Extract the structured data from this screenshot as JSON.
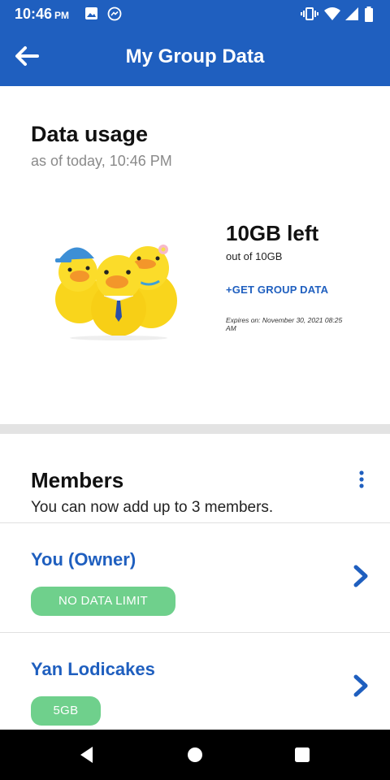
{
  "status_bar": {
    "time": "10:46",
    "ampm": "PM"
  },
  "app_bar": {
    "title": "My Group Data"
  },
  "data_usage": {
    "title": "Data usage",
    "subtitle": "as of today, 10:46 PM",
    "remaining": "10GB left",
    "total": "out of 10GB",
    "get_data_link": "+GET GROUP DATA",
    "expires": "Expires on: November 30, 2021 08:25 AM"
  },
  "members": {
    "title": "Members",
    "subtitle": "You can now add up to 3 members.",
    "list": [
      {
        "name": "You (Owner)",
        "limit": "NO DATA LIMIT"
      },
      {
        "name": "Yan Lodicakes",
        "limit": "5GB"
      }
    ]
  },
  "colors": {
    "primary": "#1f5fbf",
    "badge": "#6fd08c",
    "divider": "#e3e3e3"
  },
  "icons": [
    "photo-icon",
    "messenger-icon",
    "vibrate-icon",
    "wifi-icon",
    "signal-icon",
    "battery-icon",
    "back-arrow-icon",
    "more-vert-icon",
    "chevron-right-icon",
    "nav-back-icon",
    "nav-home-icon",
    "nav-recents-icon"
  ]
}
